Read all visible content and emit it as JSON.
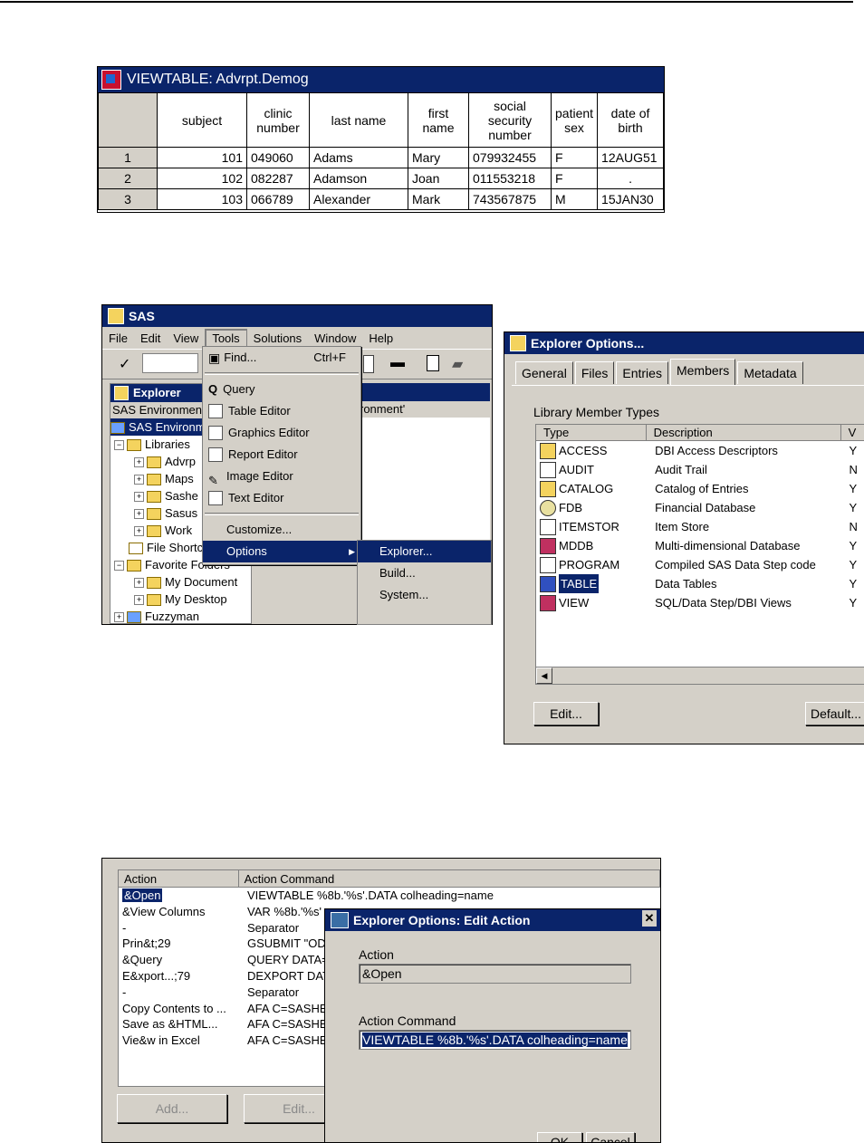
{
  "viewtable": {
    "title": "VIEWTABLE: Advrpt.Demog",
    "columns": [
      "subject",
      "clinic number",
      "last name",
      "first name",
      "social security number",
      "patient sex",
      "date of birth"
    ],
    "rows": [
      {
        "n": "1",
        "cells": [
          "101",
          "049060",
          "Adams",
          "Mary",
          "079932455",
          "F",
          "12AUG51"
        ]
      },
      {
        "n": "2",
        "cells": [
          "102",
          "082287",
          "Adamson",
          "Joan",
          "011553218",
          "F",
          "."
        ]
      },
      {
        "n": "3",
        "cells": [
          "103",
          "066789",
          "Alexander",
          "Mark",
          "743567875",
          "M",
          "15JAN30"
        ]
      }
    ]
  },
  "sas": {
    "title": "SAS",
    "menu": [
      "File",
      "Edit",
      "View",
      "Tools",
      "Solutions",
      "Window",
      "Help"
    ],
    "explorer_title": "Explorer",
    "env_label": "SAS Environment",
    "env_right": "ronment'",
    "tree": [
      "SAS Environm",
      "Libraries",
      "Advrp",
      "Maps",
      "Sashe",
      "Sasus",
      "Work",
      "File Shortc",
      "Favorite Folders",
      "My Document",
      "My Desktop",
      "Fuzzyman"
    ],
    "tools_menu": {
      "find": "Find...",
      "find_shortcut": "Ctrl+F",
      "query": "Query",
      "table_editor": "Table Editor",
      "graphics_editor": "Graphics Editor",
      "report_editor": "Report Editor",
      "image_editor": "Image Editor",
      "text_editor": "Text Editor",
      "customize": "Customize...",
      "options": "Options"
    },
    "options_submenu": [
      "Explorer...",
      "Build...",
      "System..."
    ]
  },
  "explorer_options": {
    "title": "Explorer Options...",
    "tabs": [
      "General",
      "Files",
      "Entries",
      "Members",
      "Metadata"
    ],
    "active_tab": "Members",
    "section_label": "Library Member Types",
    "col_type": "Type",
    "col_desc": "Description",
    "col_extra": "V",
    "members": [
      {
        "type": "ACCESS",
        "desc": "DBI Access Descriptors",
        "flag": "Y"
      },
      {
        "type": "AUDIT",
        "desc": "Audit Trail",
        "flag": "N"
      },
      {
        "type": "CATALOG",
        "desc": "Catalog of Entries",
        "flag": "Y"
      },
      {
        "type": "FDB",
        "desc": "Financial Database",
        "flag": "Y"
      },
      {
        "type": "ITEMSTOR",
        "desc": "Item Store",
        "flag": "N"
      },
      {
        "type": "MDDB",
        "desc": "Multi-dimensional Database",
        "flag": "Y"
      },
      {
        "type": "PROGRAM",
        "desc": "Compiled SAS Data Step code",
        "flag": "Y"
      },
      {
        "type": "TABLE",
        "desc": "Data Tables",
        "flag": "Y"
      },
      {
        "type": "VIEW",
        "desc": "SQL/Data Step/DBI Views",
        "flag": "Y"
      }
    ],
    "edit_button": "Edit...",
    "default_button": "Default..."
  },
  "actions": {
    "col_action": "Action",
    "col_command": "Action Command",
    "rows": [
      {
        "action": "&Open",
        "command": "VIEWTABLE %8b.'%s'.DATA colheading=name"
      },
      {
        "action": "&View Columns",
        "command": "VAR %8b.'%s'"
      },
      {
        "action": "-",
        "command": "Separator"
      },
      {
        "action": "Prin&t;29",
        "command": "GSUBMIT \"ODS"
      },
      {
        "action": "&Query",
        "command": "QUERY DATA="
      },
      {
        "action": "E&xport...;79",
        "command": "DEXPORT DAT"
      },
      {
        "action": "-",
        "command": "Separator"
      },
      {
        "action": "Copy Contents to ...",
        "command": "AFA C=SASHE"
      },
      {
        "action": "Save as &HTML...",
        "command": "AFA C=SASHE"
      },
      {
        "action": "Vie&w in Excel",
        "command": "AFA C=SASHE"
      }
    ],
    "add_button": "Add...",
    "edit_button": "Edit..."
  },
  "edit_action": {
    "title": "Explorer Options: Edit Action",
    "action_label": "Action",
    "action_value": "&Open",
    "command_label": "Action Command",
    "command_value": "VIEWTABLE %8b.'%s'.DATA colheading=name",
    "ok": "OK",
    "cancel": "Cancel"
  }
}
